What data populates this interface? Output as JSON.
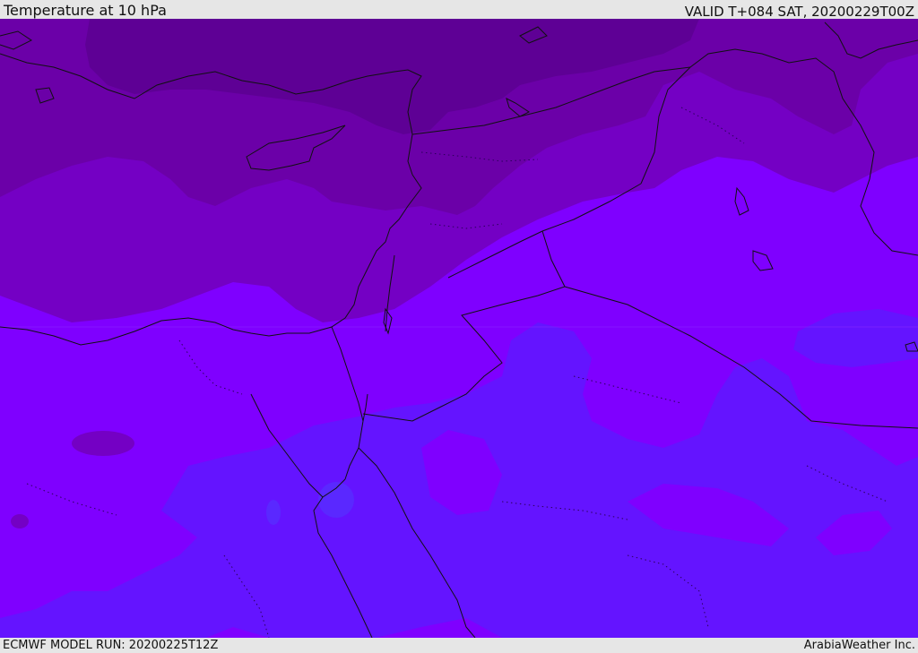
{
  "header": {
    "title": "Temperature at 10 hPa",
    "valid": "VALID T+084 SAT, 20200229T00Z"
  },
  "footer": {
    "model_run": "ECMWF MODEL RUN: 20200225T12Z",
    "credit": "ArabiaWeather Inc."
  },
  "map": {
    "colors": {
      "darkest": "#5e0095",
      "dark": "#6b00a8",
      "mid_dark": "#7400c4",
      "mid": "#7f00ff",
      "blue": "#6414ff",
      "light_blue": "#5a28ff",
      "coast": "#111111"
    }
  }
}
